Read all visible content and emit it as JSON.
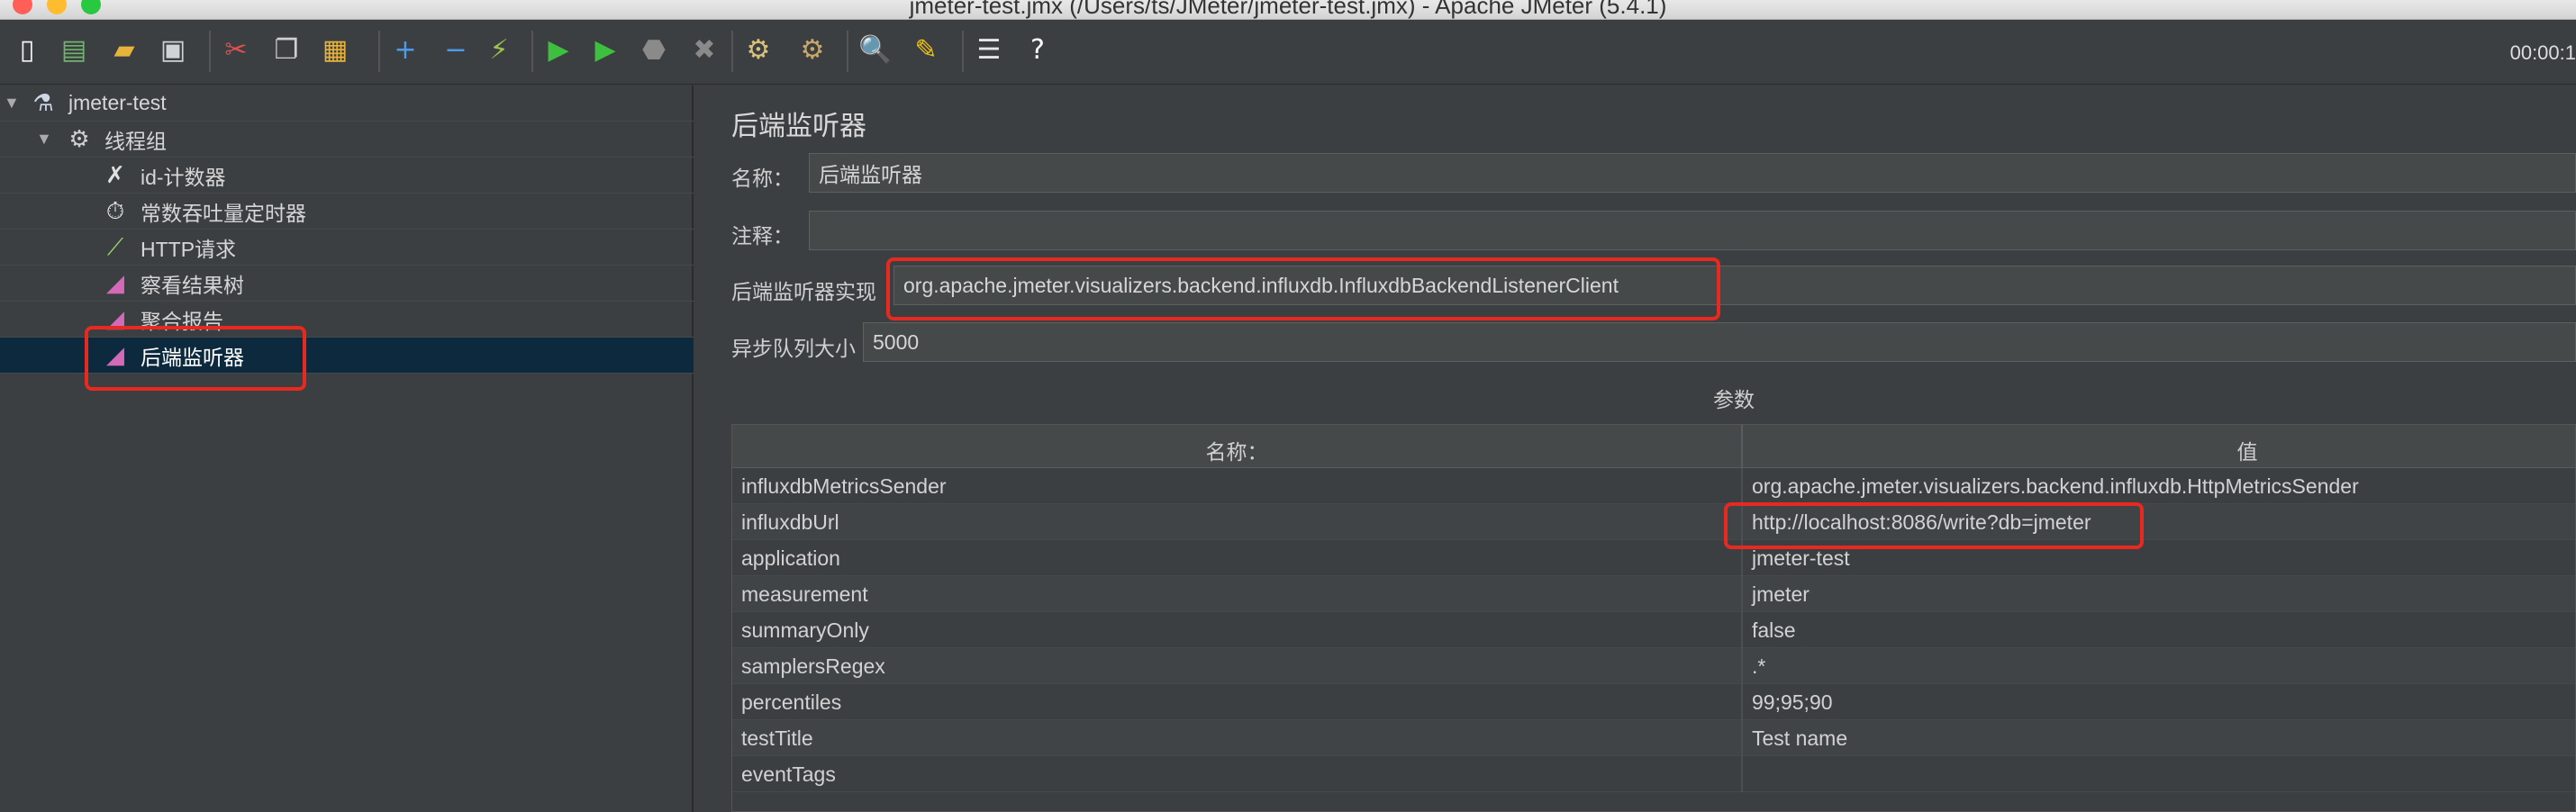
{
  "window": {
    "title": "jmeter-test.jmx (/Users/ts/JMeter/jmeter-test.jmx) - Apache JMeter (5.4.1)"
  },
  "toolbar": {
    "timer": "00:00:1",
    "buttons": [
      {
        "name": "new-icon",
        "glyph": "▯",
        "color": "#f4f4f4"
      },
      {
        "name": "templates-icon",
        "glyph": "▤",
        "color": "#6fb36f"
      },
      {
        "name": "open-icon",
        "glyph": "▰",
        "color": "#e8b33a"
      },
      {
        "name": "save-icon",
        "glyph": "▣",
        "color": "#cfd3d6"
      },
      {
        "name": "cut-icon",
        "glyph": "✂",
        "color": "#e05050"
      },
      {
        "name": "copy-icon",
        "glyph": "❐",
        "color": "#cfcfcf"
      },
      {
        "name": "paste-icon",
        "glyph": "▦",
        "color": "#e8b33a"
      },
      {
        "name": "expand-icon",
        "glyph": "+",
        "color": "#4d9be6"
      },
      {
        "name": "collapse-icon",
        "glyph": "−",
        "color": "#4d9be6"
      },
      {
        "name": "toggle-icon",
        "glyph": "⚡",
        "color": "#9fc24f"
      },
      {
        "name": "start-icon",
        "glyph": "▶",
        "color": "#3fbf3f"
      },
      {
        "name": "start-no-pauses-icon",
        "glyph": "▶",
        "color": "#3fbf3f"
      },
      {
        "name": "stop-icon",
        "glyph": "⬣",
        "color": "#8a8a8a"
      },
      {
        "name": "shutdown-icon",
        "glyph": "✖",
        "color": "#8a8a8a"
      },
      {
        "name": "clear-icon",
        "glyph": "⚙",
        "color": "#d9c27a"
      },
      {
        "name": "clear-all-icon",
        "glyph": "⚙",
        "color": "#c9a86a"
      },
      {
        "name": "search-icon",
        "glyph": "🔍",
        "color": "#cfcfcf"
      },
      {
        "name": "reset-search-icon",
        "glyph": "✎",
        "color": "#f0c419"
      },
      {
        "name": "function-helper-icon",
        "glyph": "☰",
        "color": "#e6e6e6"
      },
      {
        "name": "help-icon",
        "glyph": "?",
        "color": "#ffffff"
      }
    ]
  },
  "tree": {
    "items": [
      {
        "label": "jmeter-test",
        "icon": "flask-icon"
      },
      {
        "label": "线程组",
        "icon": "gear-icon"
      },
      {
        "label": "id-计数器",
        "icon": "tools-icon"
      },
      {
        "label": "常数吞吐量定时器",
        "icon": "stopwatch-icon"
      },
      {
        "label": "HTTP请求",
        "icon": "pipette-icon"
      },
      {
        "label": "察看结果树",
        "icon": "chart-icon"
      },
      {
        "label": "聚合报告",
        "icon": "chart-icon"
      },
      {
        "label": "后端监听器",
        "icon": "chart-icon"
      }
    ]
  },
  "panel": {
    "title": "后端监听器",
    "name_label": "名称：",
    "name_value": "后端监听器",
    "comment_label": "注释：",
    "comment_value": "",
    "impl_label": "后端监听器实现",
    "impl_value": "org.apache.jmeter.visualizers.backend.influxdb.InfluxdbBackendListenerClient",
    "queue_label": "异步队列大小",
    "queue_value": "5000",
    "params_title": "参数",
    "table": {
      "header_name": "名称：",
      "header_value": "值",
      "rows": [
        {
          "name": "influxdbMetricsSender",
          "value": "org.apache.jmeter.visualizers.backend.influxdb.HttpMetricsSender"
        },
        {
          "name": "influxdbUrl",
          "value": "http://localhost:8086/write?db=jmeter"
        },
        {
          "name": "application",
          "value": "jmeter-test"
        },
        {
          "name": "measurement",
          "value": "jmeter"
        },
        {
          "name": "summaryOnly",
          "value": "false"
        },
        {
          "name": "samplersRegex",
          "value": ".*"
        },
        {
          "name": "percentiles",
          "value": "99;95;90"
        },
        {
          "name": "testTitle",
          "value": "Test name"
        },
        {
          "name": "eventTags",
          "value": ""
        }
      ]
    }
  },
  "colors": {
    "highlight_box": "#e8291f",
    "selected_row": "#0d293e",
    "background": "#3c3f41"
  }
}
